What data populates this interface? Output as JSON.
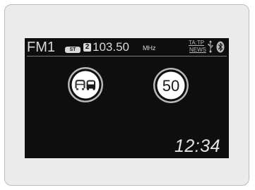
{
  "display": {
    "band": "FM1",
    "stereo_badge": "ST",
    "preset_number": "2",
    "frequency": "103.50",
    "frequency_unit": "MHz",
    "ta_tp_label": "TA:TP",
    "news_label": "NEWS",
    "usb_icon": "usb-icon",
    "bluetooth_icon": "bluetooth-icon",
    "clock": "12:34"
  },
  "traffic_signs": {
    "no_overtaking_icon": "no-overtaking-sign-icon",
    "speed_limit_value": "50"
  },
  "colors": {
    "screen_background": "#0e0e0e",
    "text": "#d8d8d8",
    "sign_ring": "#b8b8b8",
    "sign_face": "#ffffff"
  }
}
